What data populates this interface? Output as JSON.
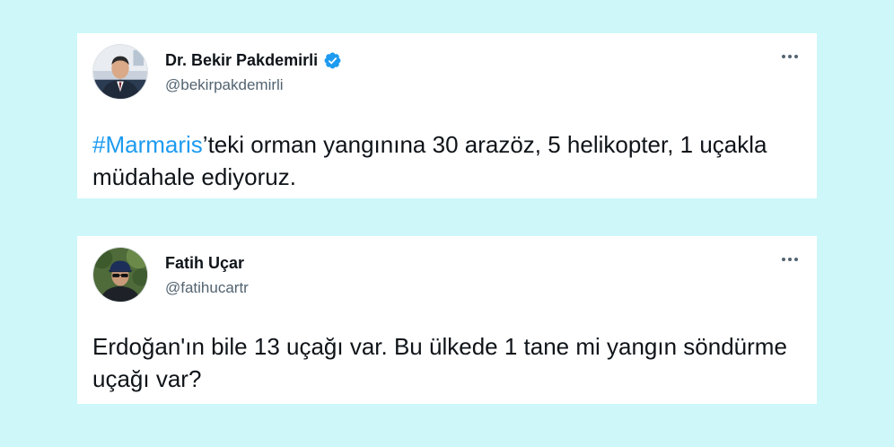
{
  "colors": {
    "background": "#cdf7f8",
    "card": "#ffffff",
    "hashtag": "#1d9bf0",
    "verified_badge": "#1d9bf0",
    "name_text": "#0f1419",
    "handle_text": "#536471"
  },
  "tweets": [
    {
      "display_name": "Dr. Bekir Pakdemirli",
      "handle": "@bekirpakdemirli",
      "verified": true,
      "avatar_icon": "avatar-portrait-suit",
      "more_icon": "more-horizontal-icon",
      "text": {
        "hashtag": "#Marmaris",
        "rest": "’teki orman yangınına 30 arazöz, 5 helikopter, 1 uçakla müdahale ediyoruz."
      }
    },
    {
      "display_name": "Fatih Uçar",
      "handle": "@fatihucartr",
      "verified": false,
      "avatar_icon": "avatar-portrait-cap-sunglasses",
      "more_icon": "more-horizontal-icon",
      "text": {
        "body": "Erdoğan'ın bile 13 uçağı var. Bu ülkede 1 tane mi yangın söndürme uçağı var?"
      }
    }
  ]
}
